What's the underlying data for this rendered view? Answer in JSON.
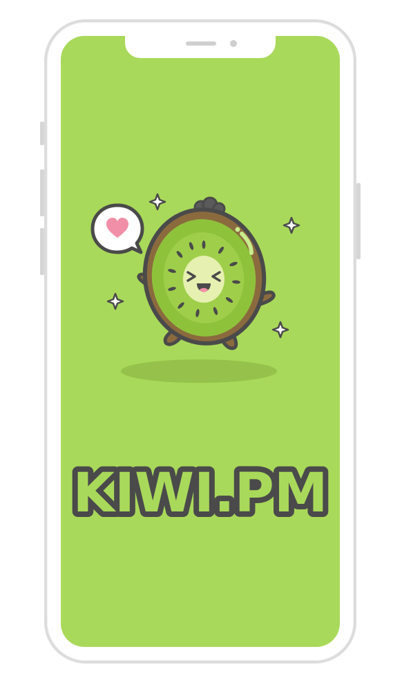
{
  "app": {
    "logo_text": "KIWI.PM"
  },
  "icons": {
    "speech_bubble": "heart-speech-bubble-icon",
    "sparkles": "sparkle-icon",
    "mascot": "kiwi-mascot"
  },
  "colors": {
    "screen_background": "#a9d95a",
    "logo_fill": "#a9d95a",
    "logo_outline": "#4a4a4a",
    "kiwi_flesh": "#8fc23b",
    "heart": "#f08fa7"
  }
}
